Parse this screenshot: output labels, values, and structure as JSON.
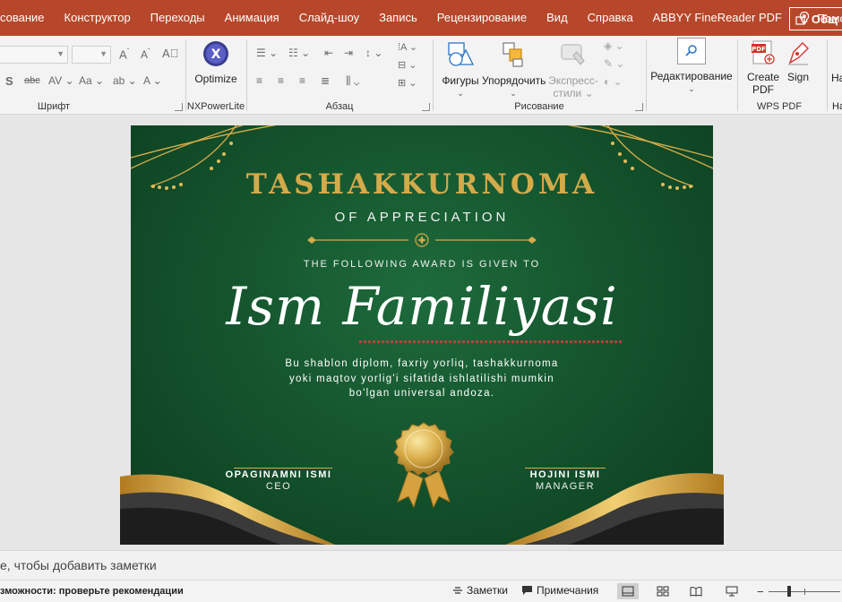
{
  "menu": {
    "items": [
      "сование",
      "Конструктор",
      "Переходы",
      "Анимация",
      "Слайд-шоу",
      "Запись",
      "Рецензирование",
      "Вид",
      "Справка",
      "ABBYY FineReader PDF"
    ],
    "help": "Помощ",
    "share": "Общ"
  },
  "ribbon": {
    "font_group": "Шрифт",
    "nxpower_group": "NXPowerLite",
    "optimize": "Optimize",
    "paragraph_group": "Абзац",
    "drawing_group": "Рисование",
    "shapes": "Фигуры",
    "arrange": "Упорядочить",
    "styles_1": "Экспресс-",
    "styles_2": "стили",
    "editing": "Редактирование",
    "create_pdf_1": "Create",
    "create_pdf_2": "PDF",
    "sign": "Sign",
    "wps_group": "WPS PDF",
    "next_group": "На",
    "next_tab": "На",
    "pdf_badge": "PDF"
  },
  "slide": {
    "title": "TASHAKKURNOMA",
    "subtitle": "OF APPRECIATION",
    "given_to": "THE FOLLOWING AWARD IS GIVEN TO",
    "name": "Ism Familiyasi",
    "description_1": "Bu shablon diplom, faxriy yorliq, tashakkurnoma",
    "description_2": "yoki maqtov yorlig'i sifatida ishlatilishi mumkin",
    "description_3": "bo'lgan universal andoza.",
    "left_signer_name": "OPAGINAMNI ISMI",
    "left_signer_role": "CEO",
    "right_signer_name": "HOJINI ISMI",
    "right_signer_role": "MANAGER"
  },
  "notes": {
    "placeholder": "е, чтобы добавить заметки"
  },
  "status": {
    "accessibility": "зможности: проверьте рекомендации",
    "notes_button": "Заметки",
    "comments_button": "Примечания"
  },
  "colors": {
    "accent": "#b7472a",
    "gold": "#d4aa4a",
    "slide_green": "#15552e"
  }
}
